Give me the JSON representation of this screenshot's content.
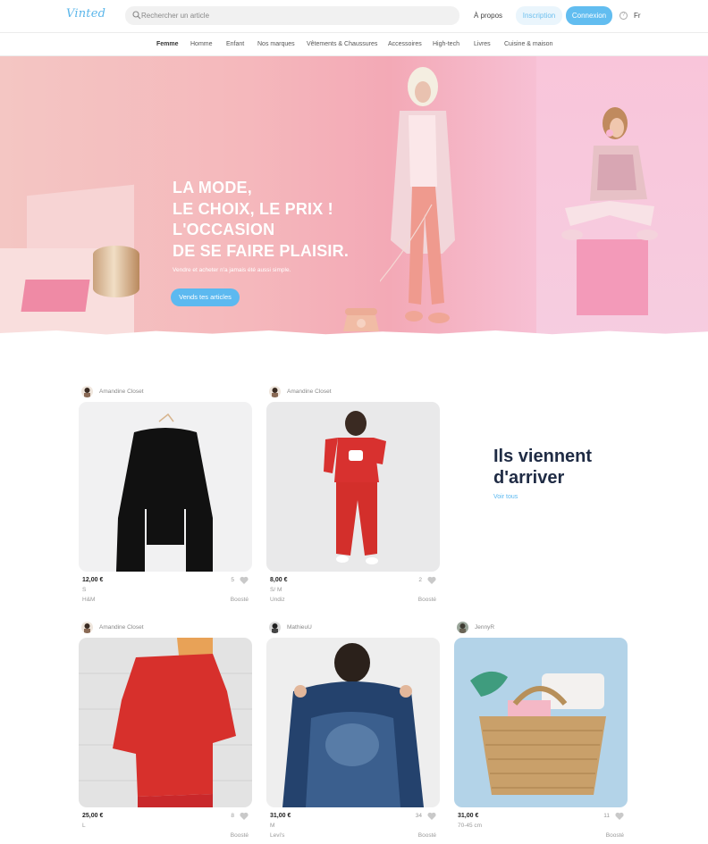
{
  "header": {
    "logo": "Vinted",
    "search_placeholder": "Rechercher un article",
    "about": "À propos",
    "signup": "Inscription",
    "login": "Connexion",
    "language": "Fr"
  },
  "categories": [
    {
      "label": "Femme",
      "active": true
    },
    {
      "label": "Homme",
      "active": false
    },
    {
      "label": "Enfant",
      "active": false
    },
    {
      "label": "Nos marques",
      "active": false
    },
    {
      "label": "Vêtements & Chaussures",
      "active": false
    },
    {
      "label": "Accessoires",
      "active": false
    },
    {
      "label": "High-tech",
      "active": false
    },
    {
      "label": "Livres",
      "active": false
    },
    {
      "label": "Cuisine & maison",
      "active": false
    }
  ],
  "hero": {
    "title_lines": [
      "LA MODE,",
      "LE CHOIX, LE PRIX !",
      "L'OCCASION",
      "DE SE FAIRE PLAISIR."
    ],
    "subtitle": "Vendre et acheter n'a jamais été aussi simple.",
    "cta": "Vends tes articles"
  },
  "arrivals": {
    "title_lines": [
      "Ils viennent",
      "d'arriver"
    ],
    "see_all": "Voir tous"
  },
  "items": [
    {
      "seller": "Amandine Closet",
      "price": "12,00 €",
      "size": "S",
      "brand": "H&M",
      "likes": "5",
      "boost": "Boosté"
    },
    {
      "seller": "Amandine Closet",
      "price": "8,00 €",
      "size": "S/ M",
      "brand": "Undiz",
      "likes": "2",
      "boost": "Boosté"
    },
    {
      "seller": "Amandine Closet",
      "price": "25,00 €",
      "size": "L",
      "brand": "",
      "likes": "8",
      "boost": "Boosté"
    },
    {
      "seller": "MathieuU",
      "price": "31,00 €",
      "size": "M",
      "brand": "Levi's",
      "likes": "34",
      "boost": "Boosté"
    },
    {
      "seller": "JennyR",
      "price": "31,00 €",
      "size": "70-45 cm",
      "brand": "",
      "likes": "11",
      "boost": "Boosté"
    }
  ],
  "colors": {
    "accent": "#5cb9f0",
    "hero_pink": "#f3a9b6",
    "title_navy": "#1f2b44"
  }
}
